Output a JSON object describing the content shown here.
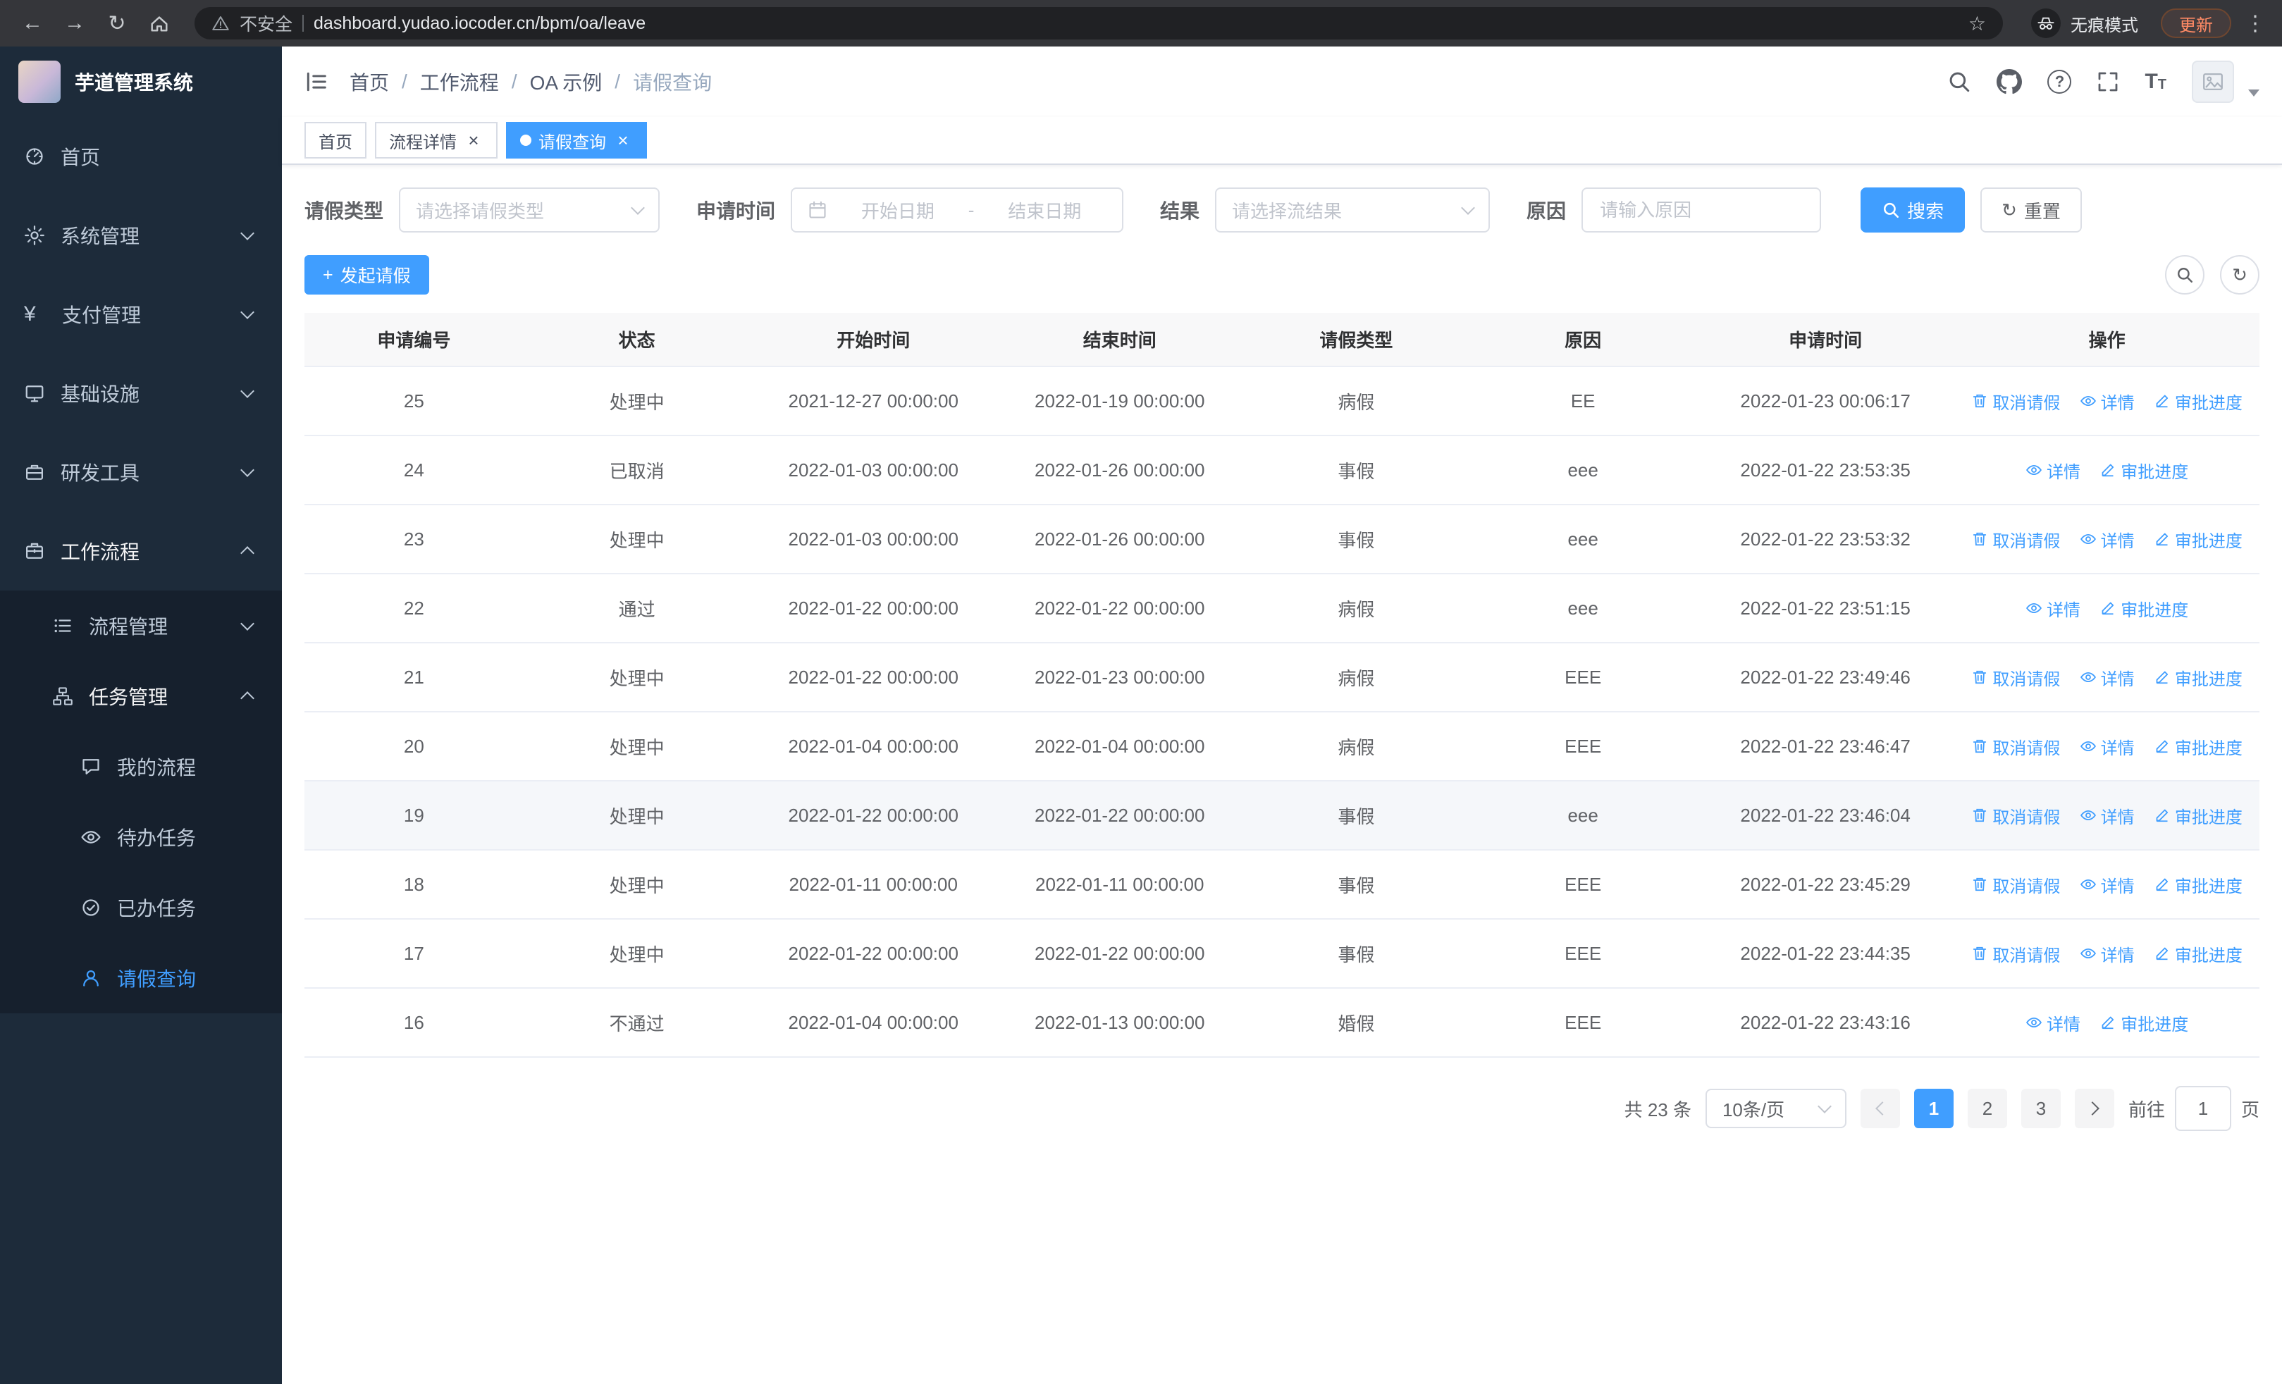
{
  "browser": {
    "url": "dashboard.yudao.iocoder.cn/bpm/oa/leave",
    "security_label": "不安全",
    "incognito_label": "无痕模式",
    "update_label": "更新"
  },
  "icons": {
    "arrow_left": "←",
    "arrow_right": "→",
    "refresh": "↻",
    "star": "☆",
    "kebab": "⋮",
    "close": "×",
    "plus": "+",
    "yen": "¥",
    "question": "?",
    "font_size": "T"
  },
  "sidebar": {
    "logo_title": "芋道管理系统",
    "items": [
      {
        "label": "首页"
      },
      {
        "label": "系统管理"
      },
      {
        "label": "支付管理"
      },
      {
        "label": "基础设施"
      },
      {
        "label": "研发工具"
      },
      {
        "label": "工作流程"
      },
      {
        "label": "流程管理"
      },
      {
        "label": "任务管理"
      },
      {
        "label": "我的流程"
      },
      {
        "label": "待办任务"
      },
      {
        "label": "已办任务"
      },
      {
        "label": "请假查询"
      }
    ]
  },
  "header": {
    "separator": "/",
    "breadcrumb": [
      "首页",
      "工作流程",
      "OA 示例",
      "请假查询"
    ]
  },
  "tabs": [
    {
      "label": "首页"
    },
    {
      "label": "流程详情"
    },
    {
      "label": "请假查询"
    }
  ],
  "filters": {
    "leave_type_label": "请假类型",
    "leave_type_placeholder": "请选择请假类型",
    "apply_time_label": "申请时间",
    "start_date_placeholder": "开始日期",
    "date_separator": "-",
    "end_date_placeholder": "结束日期",
    "result_label": "结果",
    "result_placeholder": "请选择流结果",
    "reason_label": "原因",
    "reason_placeholder": "请输入原因",
    "search_label": "搜索",
    "reset_label": "重置"
  },
  "toolbar": {
    "create_label": "发起请假"
  },
  "table": {
    "columns": [
      "申请编号",
      "状态",
      "开始时间",
      "结束时间",
      "请假类型",
      "原因",
      "申请时间",
      "操作"
    ],
    "action_labels": {
      "cancel": "取消请假",
      "detail": "详情",
      "progress": "审批进度"
    },
    "rows": [
      {
        "id": "25",
        "status": "处理中",
        "start": "2021-12-27 00:00:00",
        "end": "2022-01-19 00:00:00",
        "type": "病假",
        "reason": "EE",
        "applied": "2022-01-23 00:06:17"
      },
      {
        "id": "24",
        "status": "已取消",
        "start": "2022-01-03 00:00:00",
        "end": "2022-01-26 00:00:00",
        "type": "事假",
        "reason": "eee",
        "applied": "2022-01-22 23:53:35"
      },
      {
        "id": "23",
        "status": "处理中",
        "start": "2022-01-03 00:00:00",
        "end": "2022-01-26 00:00:00",
        "type": "事假",
        "reason": "eee",
        "applied": "2022-01-22 23:53:32"
      },
      {
        "id": "22",
        "status": "通过",
        "start": "2022-01-22 00:00:00",
        "end": "2022-01-22 00:00:00",
        "type": "病假",
        "reason": "eee",
        "applied": "2022-01-22 23:51:15"
      },
      {
        "id": "21",
        "status": "处理中",
        "start": "2022-01-22 00:00:00",
        "end": "2022-01-23 00:00:00",
        "type": "病假",
        "reason": "EEE",
        "applied": "2022-01-22 23:49:46"
      },
      {
        "id": "20",
        "status": "处理中",
        "start": "2022-01-04 00:00:00",
        "end": "2022-01-04 00:00:00",
        "type": "病假",
        "reason": "EEE",
        "applied": "2022-01-22 23:46:47"
      },
      {
        "id": "19",
        "status": "处理中",
        "start": "2022-01-22 00:00:00",
        "end": "2022-01-22 00:00:00",
        "type": "事假",
        "reason": "eee",
        "applied": "2022-01-22 23:46:04"
      },
      {
        "id": "18",
        "status": "处理中",
        "start": "2022-01-11 00:00:00",
        "end": "2022-01-11 00:00:00",
        "type": "事假",
        "reason": "EEE",
        "applied": "2022-01-22 23:45:29"
      },
      {
        "id": "17",
        "status": "处理中",
        "start": "2022-01-22 00:00:00",
        "end": "2022-01-22 00:00:00",
        "type": "事假",
        "reason": "EEE",
        "applied": "2022-01-22 23:44:35"
      },
      {
        "id": "16",
        "status": "不通过",
        "start": "2022-01-04 00:00:00",
        "end": "2022-01-13 00:00:00",
        "type": "婚假",
        "reason": "EEE",
        "applied": "2022-01-22 23:43:16"
      }
    ]
  },
  "pagination": {
    "total_label": "共 23 条",
    "page_size": "10条/页",
    "pages": [
      "1",
      "2",
      "3"
    ],
    "goto_label": "前往",
    "goto_value": "1",
    "page_unit": "页"
  }
}
